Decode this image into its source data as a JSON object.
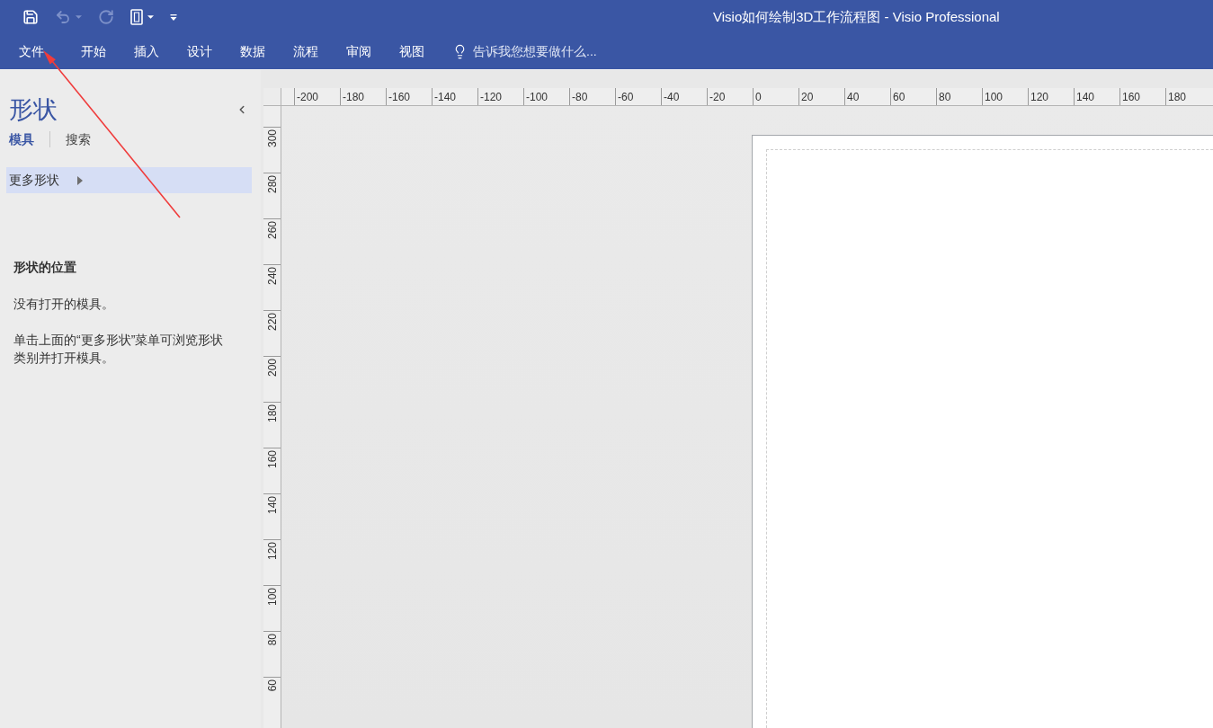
{
  "window": {
    "title": "Visio如何绘制3D工作流程图 - Visio Professional"
  },
  "quick_access": [
    {
      "kind": "save",
      "disabled": false,
      "dropdown": false
    },
    {
      "kind": "undo",
      "disabled": true,
      "dropdown": true
    },
    {
      "kind": "redo",
      "disabled": true,
      "dropdown": false
    },
    {
      "kind": "new",
      "disabled": false,
      "dropdown": true
    },
    {
      "kind": "customize",
      "disabled": false,
      "dropdown": false
    }
  ],
  "ribbon_tabs": [
    {
      "label": "文件",
      "selected": false
    },
    {
      "label": "开始",
      "selected": false
    },
    {
      "label": "插入",
      "selected": false
    },
    {
      "label": "设计",
      "selected": false
    },
    {
      "label": "数据",
      "selected": false
    },
    {
      "label": "流程",
      "selected": false
    },
    {
      "label": "审阅",
      "selected": false
    },
    {
      "label": "视图",
      "selected": false
    }
  ],
  "tell_me": {
    "placeholder": "告诉我您想要做什么..."
  },
  "shapes_panel": {
    "title": "形状",
    "tabs": [
      {
        "label": "模具",
        "selected": true
      },
      {
        "label": "搜索",
        "selected": false
      }
    ],
    "menu_items": [
      {
        "label": "更多形状",
        "selected": true
      }
    ],
    "heading": "形状的位置",
    "paragraphs": [
      "没有打开的模具。",
      "单击上面的“更多形状”菜单可浏览形状类别并打开模具。"
    ]
  },
  "rulers": {
    "horizontal": [
      "-200",
      "-180",
      "-160",
      "-140",
      "-120",
      "-100",
      "-80",
      "-60",
      "-40",
      "-20",
      "0",
      "20",
      "40",
      "60",
      "80",
      "100",
      "120",
      "140",
      "160",
      "180"
    ],
    "vertical": [
      "300",
      "280",
      "260",
      "240",
      "220",
      "200",
      "180",
      "160",
      "140",
      "120",
      "100",
      "80",
      "60"
    ]
  }
}
